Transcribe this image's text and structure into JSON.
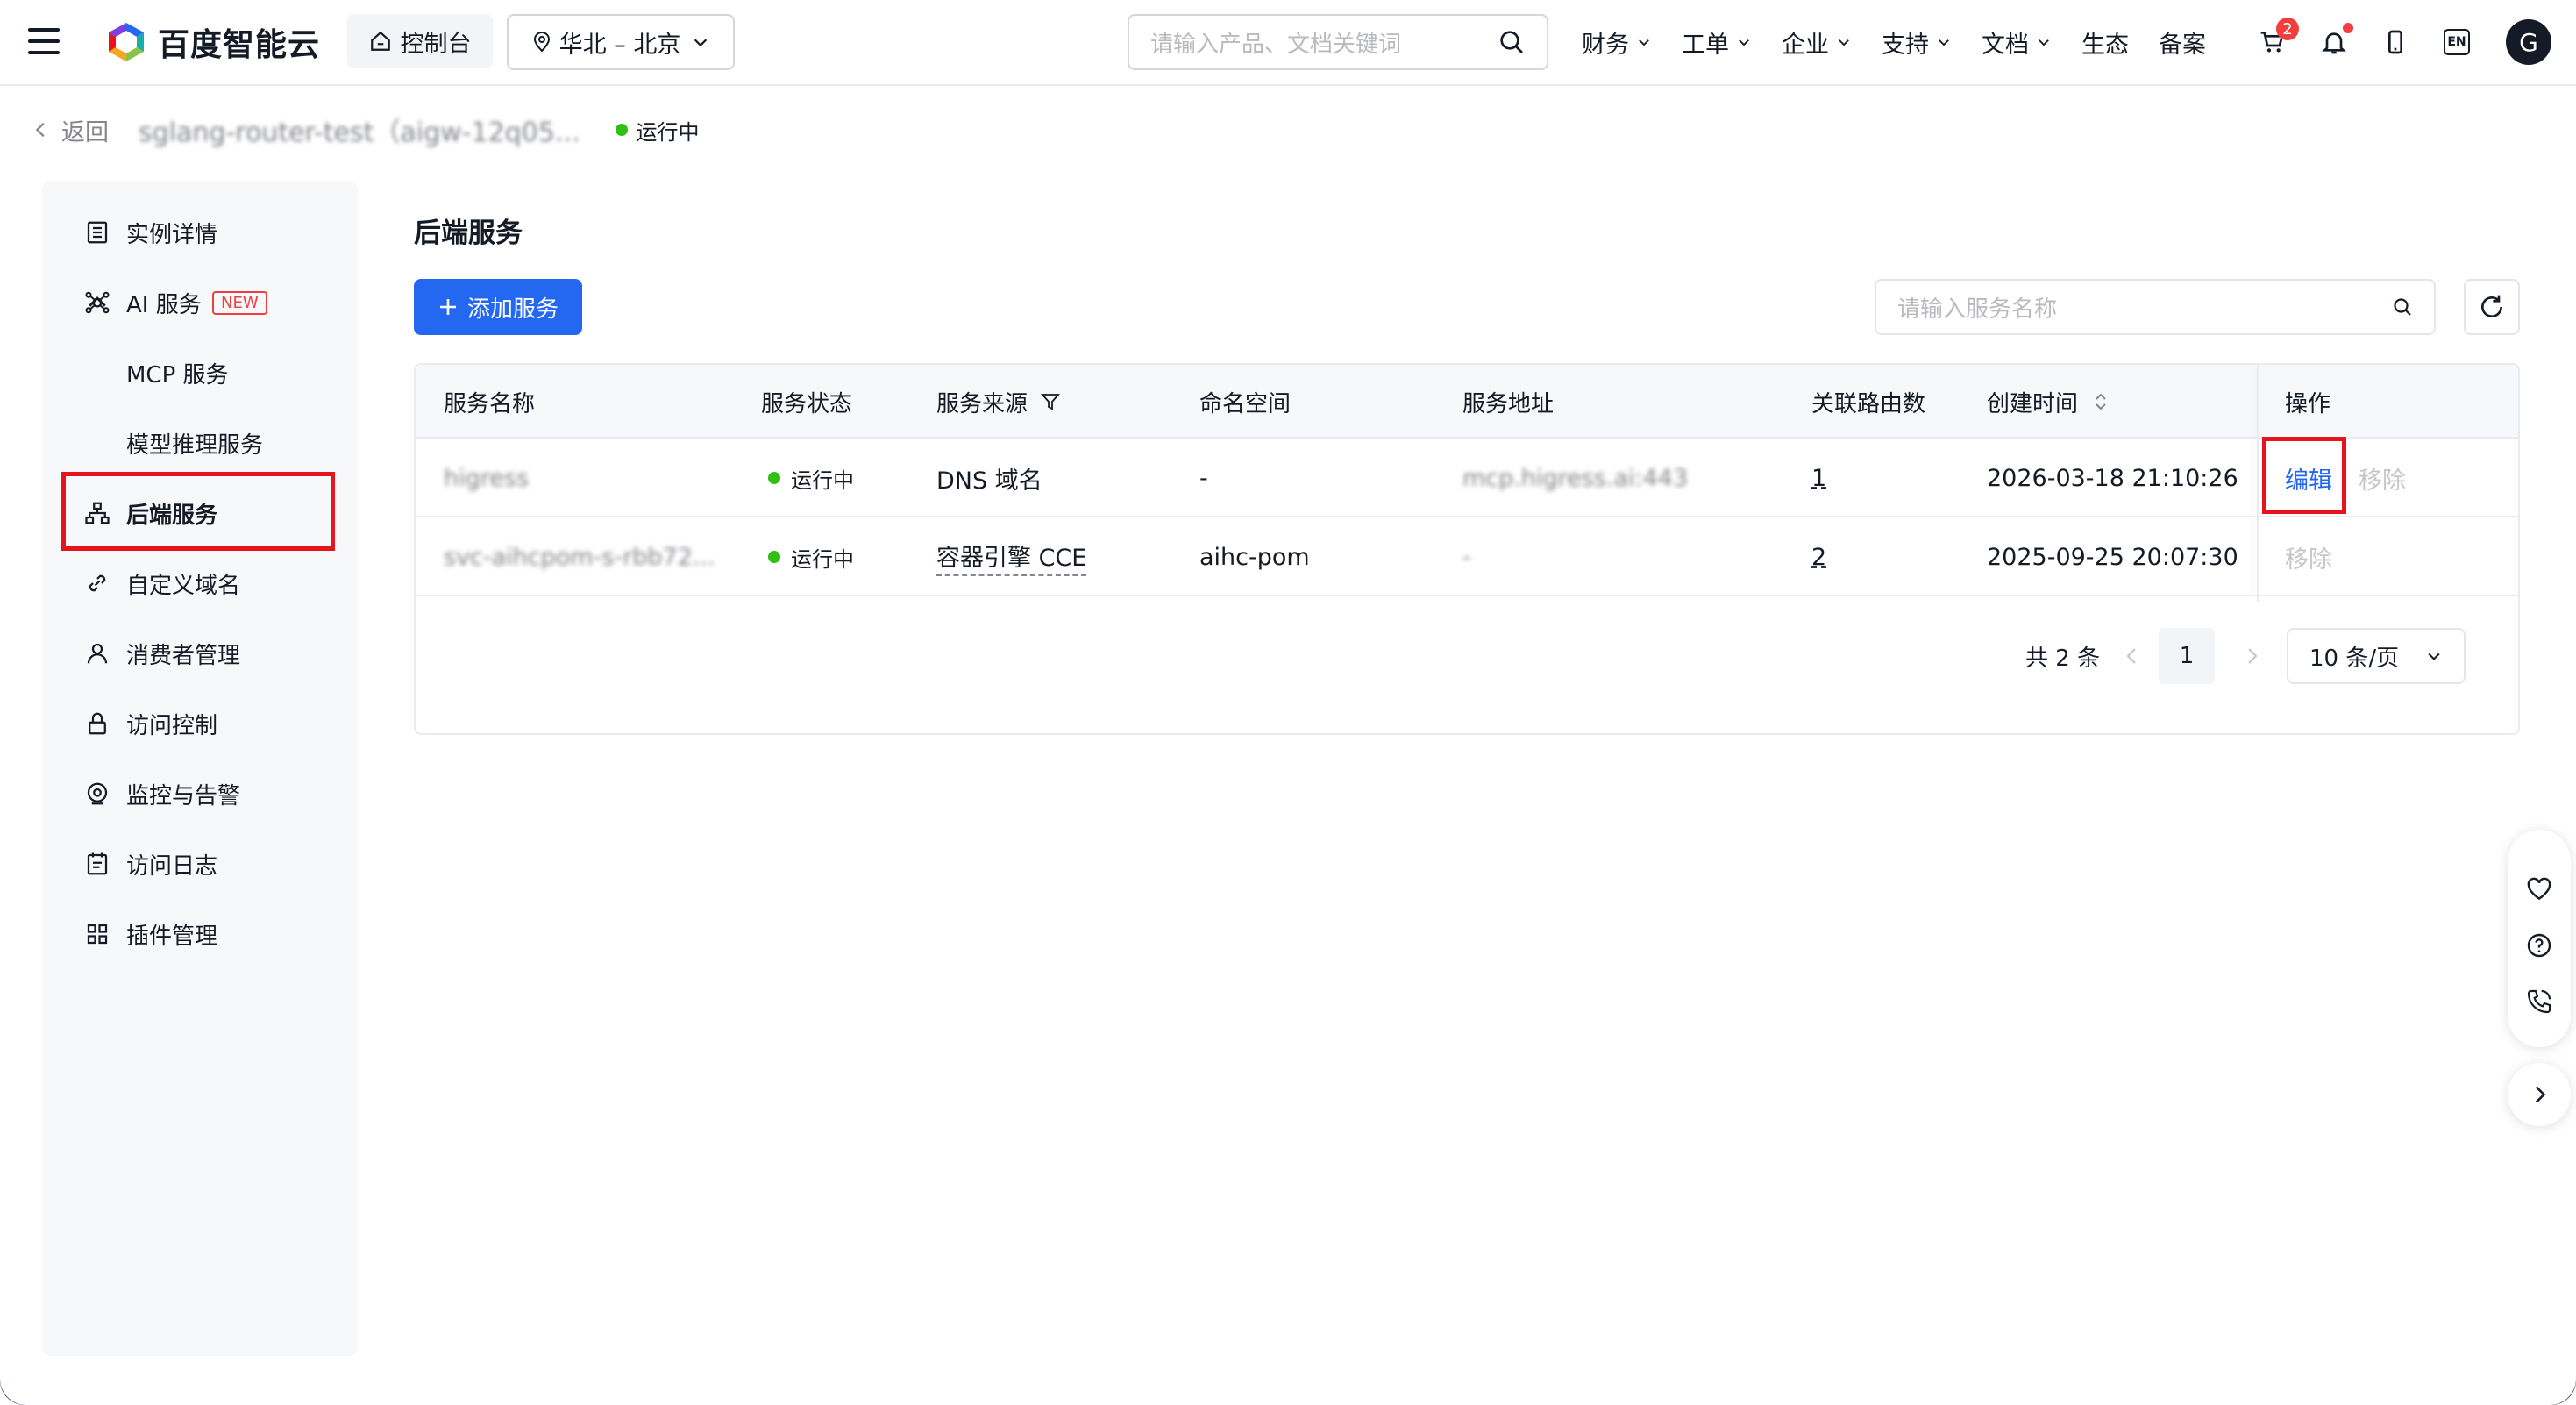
{
  "topbar": {
    "brand": "百度智能云",
    "console_label": "控制台",
    "region_label": "华北 – 北京",
    "search_placeholder": "请输入产品、文档关键词",
    "nav": [
      {
        "label": "财务",
        "has_menu": true
      },
      {
        "label": "工单",
        "has_menu": true
      },
      {
        "label": "企业",
        "has_menu": true
      },
      {
        "label": "支持",
        "has_menu": true
      },
      {
        "label": "文档",
        "has_menu": true
      },
      {
        "label": "生态",
        "has_menu": false
      },
      {
        "label": "备案",
        "has_menu": false
      }
    ],
    "cart_badge": "2",
    "lang_label": "EN",
    "avatar_letter": "G"
  },
  "breadcrumb": {
    "back_label": "返回",
    "instance_name": "sglang-router-test（aigw-12q05...",
    "instance_status": "运行中"
  },
  "sidebar": {
    "items": [
      {
        "label": "实例详情",
        "icon": "list-icon"
      },
      {
        "label": "AI 服务",
        "icon": "ai-icon",
        "tag": "NEW",
        "expanded": true
      },
      {
        "label": "MCP 服务",
        "sub": true
      },
      {
        "label": "模型推理服务",
        "sub": true
      },
      {
        "label": "后端服务",
        "icon": "network-icon",
        "active": true
      },
      {
        "label": "自定义域名",
        "icon": "link-icon"
      },
      {
        "label": "消费者管理",
        "icon": "user-icon"
      },
      {
        "label": "访问控制",
        "icon": "lock-icon"
      },
      {
        "label": "监控与告警",
        "icon": "monitor-icon"
      },
      {
        "label": "访问日志",
        "icon": "log-icon"
      },
      {
        "label": "插件管理",
        "icon": "grid-icon"
      }
    ]
  },
  "main": {
    "title": "后端服务",
    "add_button": "添加服务",
    "search_placeholder": "请输入服务名称",
    "columns": [
      "服务名称",
      "服务状态",
      "服务来源",
      "命名空间",
      "服务地址",
      "关联路由数",
      "创建时间",
      "操作"
    ],
    "rows": [
      {
        "name": "higress",
        "status": "运行中",
        "source": "DNS 域名",
        "namespace": "-",
        "address": "mcp.higress.ai:443",
        "routes": "1",
        "created": "2026-03-18 21:10:26",
        "edit": "编辑",
        "remove": "移除"
      },
      {
        "name": "svc-aihcpom-s-rbb72...",
        "status": "运行中",
        "source": "容器引擎 CCE",
        "namespace": "aihc-pom",
        "address": "-",
        "routes": "2",
        "created": "2025-09-25 20:07:30",
        "remove": "移除"
      }
    ],
    "pagination": {
      "total": "共 2 条",
      "current_page": "1",
      "page_size": "10 条/页"
    }
  },
  "colors": {
    "primary": "#2468f2",
    "status_green": "#30bf13",
    "highlight_red": "#e8141d",
    "new_tag_red": "#f33e3e"
  }
}
